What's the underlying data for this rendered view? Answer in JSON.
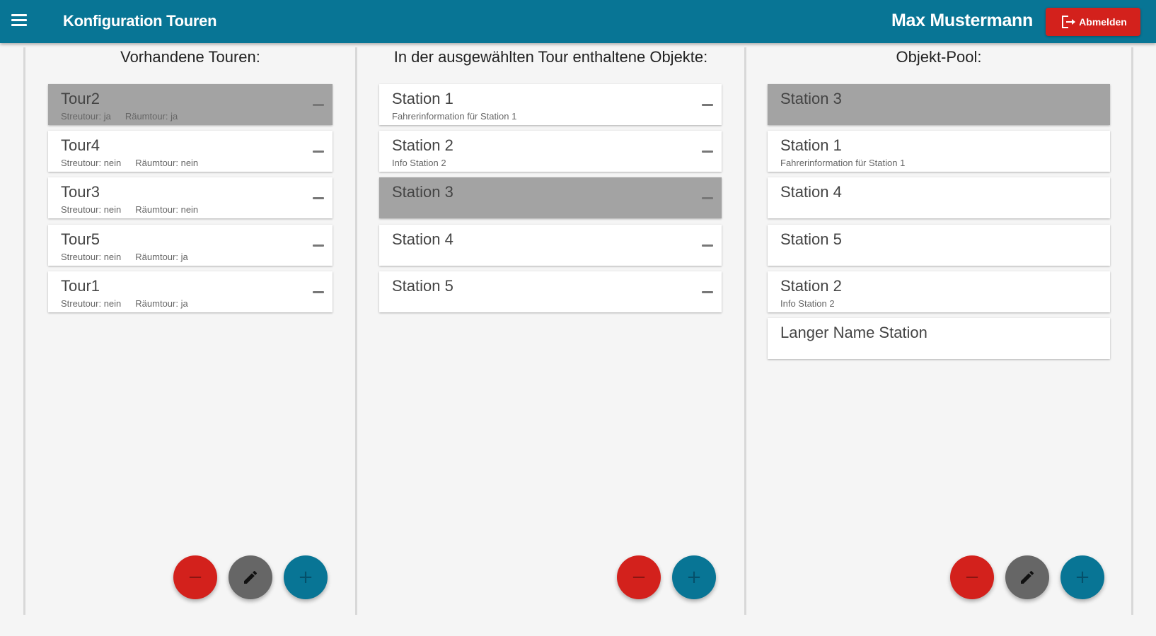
{
  "header": {
    "title": "Konfiguration Touren",
    "user": "Max Mustermann",
    "logout_label": "Abmelden",
    "menu_icon": "hamburger-menu-icon",
    "bar_color": "#087595",
    "logout_color": "#d3211c"
  },
  "columns": {
    "tours": {
      "title": "Vorhandene Touren:",
      "items": [
        {
          "name": "Tour2",
          "streutour": "Streutour: ja",
          "raeumtour": "Räumtour: ja",
          "selected": true
        },
        {
          "name": "Tour4",
          "streutour": "Streutour: nein",
          "raeumtour": "Räumtour: nein",
          "selected": false
        },
        {
          "name": "Tour3",
          "streutour": "Streutour: nein",
          "raeumtour": "Räumtour: nein",
          "selected": false
        },
        {
          "name": "Tour5",
          "streutour": "Streutour: nein",
          "raeumtour": "Räumtour: ja",
          "selected": false
        },
        {
          "name": "Tour1",
          "streutour": "Streutour: nein",
          "raeumtour": "Räumtour: ja",
          "selected": false
        }
      ]
    },
    "tour_objects": {
      "title": "In der ausgewählten Tour enthaltene Objekte:",
      "items": [
        {
          "name": "Station 1",
          "info": "Fahrerinformation für Station 1",
          "selected": false
        },
        {
          "name": "Station 2",
          "info": "Info Station 2",
          "selected": false
        },
        {
          "name": "Station 3",
          "info": "",
          "selected": true
        },
        {
          "name": "Station 4",
          "info": "",
          "selected": false
        },
        {
          "name": "Station 5",
          "info": "",
          "selected": false
        }
      ]
    },
    "pool": {
      "title": "Objekt-Pool:",
      "items": [
        {
          "name": "Station 3",
          "info": "",
          "selected": true
        },
        {
          "name": "Station 1",
          "info": "Fahrerinformation für Station 1",
          "selected": false
        },
        {
          "name": "Station 4",
          "info": "",
          "selected": false
        },
        {
          "name": "Station 5",
          "info": "",
          "selected": false
        },
        {
          "name": "Station 2",
          "info": "Info Station 2",
          "selected": false
        },
        {
          "name": "Langer Name Station",
          "info": "",
          "selected": false
        }
      ]
    }
  },
  "actions": {
    "remove_icon": "minus-icon",
    "edit_icon": "pencil-icon",
    "add_icon": "plus-icon",
    "remove_color": "#d3211c",
    "edit_color": "#666666",
    "add_color": "#087595"
  }
}
